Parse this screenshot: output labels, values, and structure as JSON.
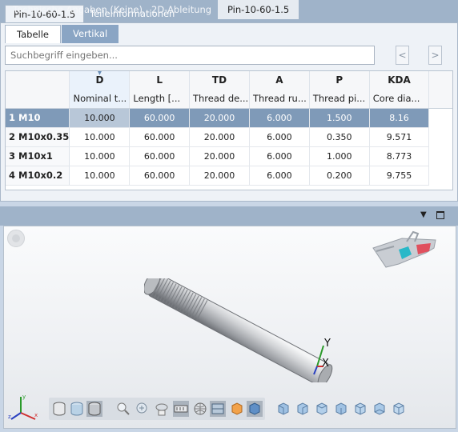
{
  "top_tabs": [
    "Pin-10-60-1.5",
    "Teileinformationen"
  ],
  "sub_tabs": [
    "Tabelle",
    "Vertikal"
  ],
  "search": {
    "placeholder": "Suchbegriff eingeben..."
  },
  "nav": {
    "prev": "<",
    "next": ">"
  },
  "table": {
    "columns": [
      {
        "key": "D",
        "desc": "Nominal t..."
      },
      {
        "key": "L",
        "desc": "Length [..."
      },
      {
        "key": "TD",
        "desc": "Thread de..."
      },
      {
        "key": "A",
        "desc": "Thread ru..."
      },
      {
        "key": "P",
        "desc": "Thread pi..."
      },
      {
        "key": "KDA",
        "desc": "Core dia..."
      }
    ],
    "rows": [
      {
        "label": "1 M10",
        "values": [
          "10.000",
          "60.000",
          "20.000",
          "6.000",
          "1.500",
          "8.16"
        ]
      },
      {
        "label": "2 M10x0.35",
        "values": [
          "10.000",
          "60.000",
          "20.000",
          "6.000",
          "0.350",
          "9.571"
        ]
      },
      {
        "label": "3 M10x1",
        "values": [
          "10.000",
          "60.000",
          "20.000",
          "6.000",
          "1.000",
          "8.773"
        ]
      },
      {
        "label": "4 M10x0.2",
        "values": [
          "10.000",
          "60.000",
          "20.000",
          "6.000",
          "0.200",
          "9.755"
        ]
      }
    ]
  },
  "bottom_tabs": [
    "Technische Angaben (Keine)",
    "2D-Ableitung",
    "Pin-10-60-1.5"
  ],
  "viewport": {
    "axis_labels": {
      "x": "X",
      "y": "Y"
    }
  },
  "colors": {
    "accent": "#7f9ab8",
    "tab_strip": "#9fb3c9",
    "axis_x": "#d03030",
    "axis_y": "#2a9a2a",
    "axis_z": "#2a40c0"
  }
}
